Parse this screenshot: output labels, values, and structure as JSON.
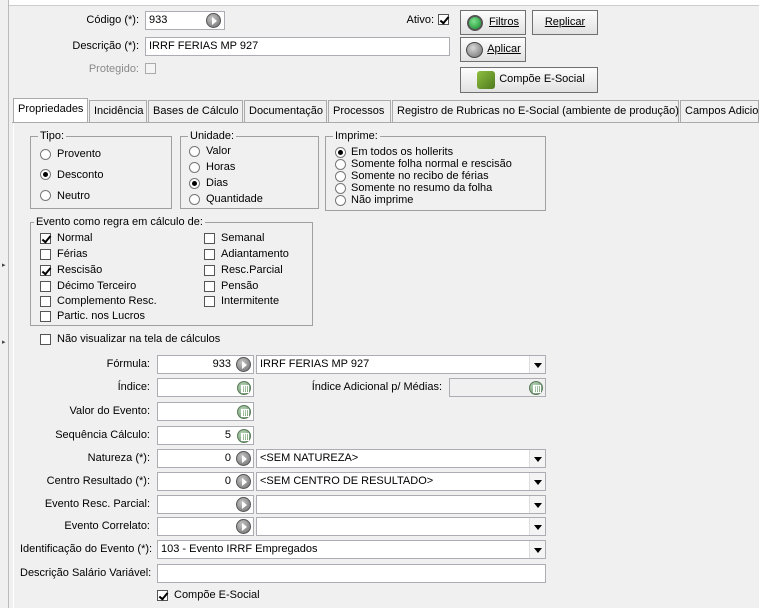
{
  "header": {
    "codigo_label": "Código (*):",
    "codigo_value": "933",
    "descricao_label": "Descrição (*):",
    "descricao_value": "IRRF FERIAS MP 927",
    "protegido_label": "Protegido:",
    "ativo_label": "Ativo:",
    "filtros_label": "Filtros",
    "replicar_label": "Replicar",
    "aplicar_label": "Aplicar",
    "compoe_label": "Compõe E-Social"
  },
  "tabs": [
    {
      "label": "Propriedades"
    },
    {
      "label": "Incidência"
    },
    {
      "label": "Bases de Cálculo"
    },
    {
      "label": "Documentação"
    },
    {
      "label": "Processos"
    },
    {
      "label": "Registro de Rubricas no E-Social (ambiente de produção)"
    },
    {
      "label": "Campos Adicionais"
    }
  ],
  "tipo": {
    "title": "Tipo:",
    "options": [
      "Provento",
      "Desconto",
      "Neutro"
    ],
    "selected": "Desconto"
  },
  "unidade": {
    "title": "Unidade:",
    "options": [
      "Valor",
      "Horas",
      "Dias",
      "Quantidade"
    ],
    "selected": "Dias"
  },
  "imprime": {
    "title": "Imprime:",
    "options": [
      "Em todos os hollerits",
      "Somente folha normal e rescisão",
      "Somente no recibo de férias",
      "Somente no resumo da folha",
      "Não imprime"
    ],
    "selected": "Em todos os hollerits"
  },
  "evento": {
    "title": "Evento como regra em cálculo de:",
    "left": [
      "Normal",
      "Férias",
      "Rescisão",
      "Décimo Terceiro",
      "Complemento Resc.",
      "Partic. nos Lucros"
    ],
    "right": [
      "Semanal",
      "Adiantamento",
      "Resc.Parcial",
      "Pensão",
      "Intermitente"
    ],
    "checked": [
      "Normal",
      "Rescisão"
    ]
  },
  "nao_visualizar_label": "Não visualizar na tela de cálculos",
  "form": {
    "formula_label": "Fórmula:",
    "formula_value": "933",
    "formula_desc": "IRRF FERIAS MP 927",
    "indice_label": "Índice:",
    "indice_adicional_label": "Índice Adicional p/ Médias:",
    "valor_evento_label": "Valor do Evento:",
    "sequencia_label": "Sequência Cálculo:",
    "sequencia_value": "5",
    "natureza_label": "Natureza (*):",
    "natureza_value": "0",
    "natureza_desc": "<SEM NATUREZA>",
    "centro_label": "Centro Resultado (*):",
    "centro_value": "0",
    "centro_desc": "<SEM CENTRO DE RESULTADO>",
    "resc_parcial_label": "Evento Resc. Parcial:",
    "correlato_label": "Evento Correlato:",
    "identificacao_label": "Identificação do Evento (*):",
    "identificacao_value": "103 - Evento IRRF Empregados",
    "salario_variavel_label": "Descrição Salário Variável:",
    "compoe_esocial_label": "Compõe E-Social"
  }
}
